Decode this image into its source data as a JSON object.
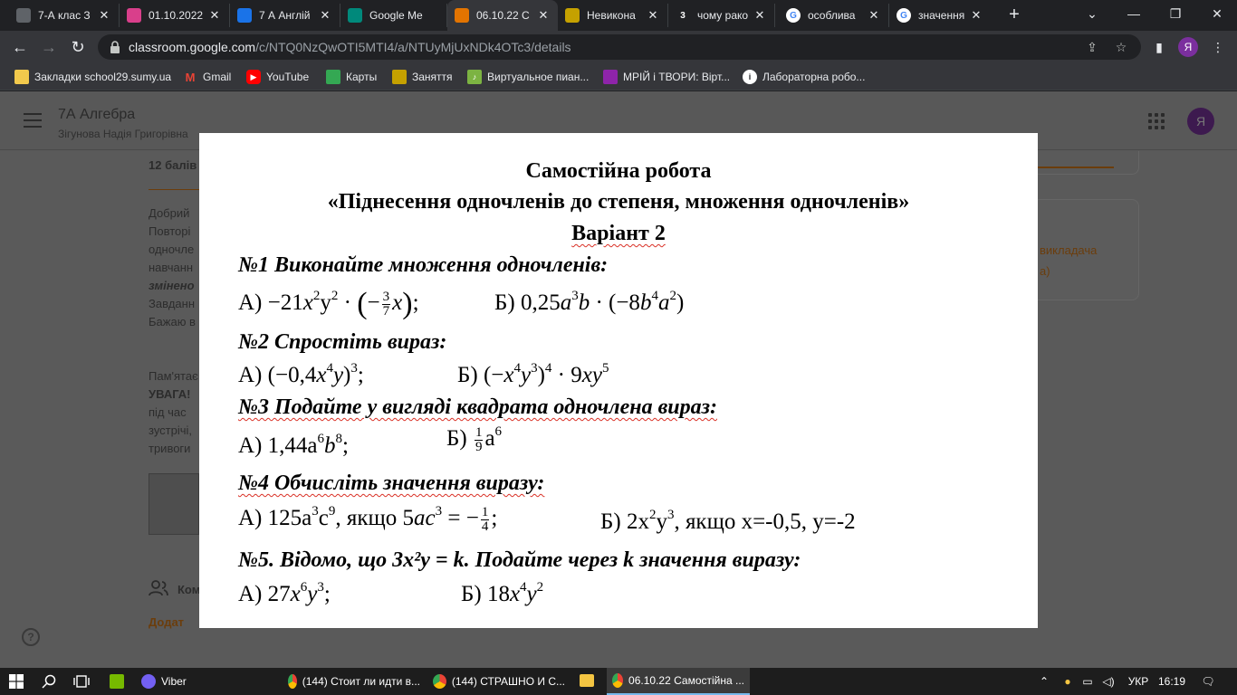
{
  "browser": {
    "tabs": [
      {
        "title": "7-А клас З",
        "icon_color": "#5f6368",
        "active": false
      },
      {
        "title": "01.10.2022",
        "icon_color": "#d93f8b",
        "active": false
      },
      {
        "title": "7 А Англій",
        "icon_color": "#1a73e8",
        "active": false
      },
      {
        "title": "Google Me",
        "icon_color": "#00897b",
        "active": false
      },
      {
        "title": "06.10.22 С",
        "icon_color": "#e37400",
        "active": true
      },
      {
        "title": "Невикона",
        "icon_color": "#c5a100",
        "active": false
      },
      {
        "title": "чому рако",
        "icon_color": "#202124",
        "icon_text": "3",
        "active": false
      },
      {
        "title": "особлива",
        "icon_color": "#ffffff",
        "icon_text": "G",
        "active": false
      },
      {
        "title": "значення",
        "icon_color": "#ffffff",
        "icon_text": "G",
        "active": false
      }
    ],
    "new_tab": "+",
    "url_host": "classroom.google.com",
    "url_path": "/c/NTQ0NzQwOTI5MTI4/a/NTUyMjUxNDk4OTc3/details",
    "profile_initial": "Я",
    "bookmarks": [
      {
        "label": "Закладки school29.sumy.ua",
        "icon": "folder-icon",
        "color": "#f2c94c"
      },
      {
        "label": "Gmail",
        "icon": "gmail-icon",
        "color": "#ea4335"
      },
      {
        "label": "YouTube",
        "icon": "youtube-icon",
        "color": "#ff0000"
      },
      {
        "label": "Карты",
        "icon": "maps-icon",
        "color": "#34a853"
      },
      {
        "label": "Заняття",
        "icon": "classroom-icon",
        "color": "#c5a100"
      },
      {
        "label": "Виртуальное пиан...",
        "icon": "piano-icon",
        "color": "#7cb342"
      },
      {
        "label": "МРІЙ і ТВОРИ: Вірт...",
        "icon": "mriy-icon",
        "color": "#8e24aa"
      },
      {
        "label": "Лабораторна робо...",
        "icon": "lab-icon",
        "color": "#ffffff"
      }
    ]
  },
  "classroom": {
    "course_title": "7А Алгебра",
    "teacher": "Зігунова Надія Григорівна",
    "points": "12 балів",
    "avatar_initial": "Я",
    "body_lines": [
      "Добрий",
      "Повторі",
      "одночле",
      "навчанн",
      "змінено",
      "Завданн",
      "Бажаю в"
    ],
    "reminder_lines": [
      "Пам'ятає",
      "УВАГА!",
      "під час",
      "зустрічі,",
      "тривоги"
    ],
    "comments_label": "Ком",
    "add_label": "Додат",
    "side_lines": [
      "викладача",
      "а)"
    ]
  },
  "document": {
    "title_line1": "Самостійна робота",
    "title_line2": "«Піднесення одночленів до степеня, множення одночленів»",
    "variant": "Варіант 2",
    "task1": "№1 Виконайте множення одночленів:",
    "task2": "№2 Спростіть вираз:",
    "task3": "№3 Подайте у вигляді квадрата одночлена вираз:",
    "task4": "№4 Обчисліть значення виразу:",
    "task5": "№5. Відомо, що 3x²y = k. Подайте через k  значення виразу:",
    "t1a_label": "А)",
    "t1b_label": "Б)",
    "t2a_label": "А)",
    "t2b_label": "Б)",
    "t3a_label": "А)",
    "t3b_label": "Б)",
    "t4a_label": "А)",
    "t4b_label": "Б)",
    "t5a_label": "А)",
    "t5b_label": "Б)",
    "t4a_condition": ", якщо",
    "t4b_condition": ", якщо x=-0,5, y=-2"
  },
  "taskbar": {
    "items": [
      {
        "label": "Viber",
        "color": "#7360f2"
      },
      {
        "label": "(144) Стоит ли идти в...",
        "color": "#1a73e8"
      },
      {
        "label": "(144) СТРАШНО И С...",
        "color": "#1a73e8"
      },
      {
        "label": "06.10.22 Самостійна ...",
        "color": "#1a73e8"
      }
    ],
    "lang": "УКР",
    "time": "16:19"
  }
}
